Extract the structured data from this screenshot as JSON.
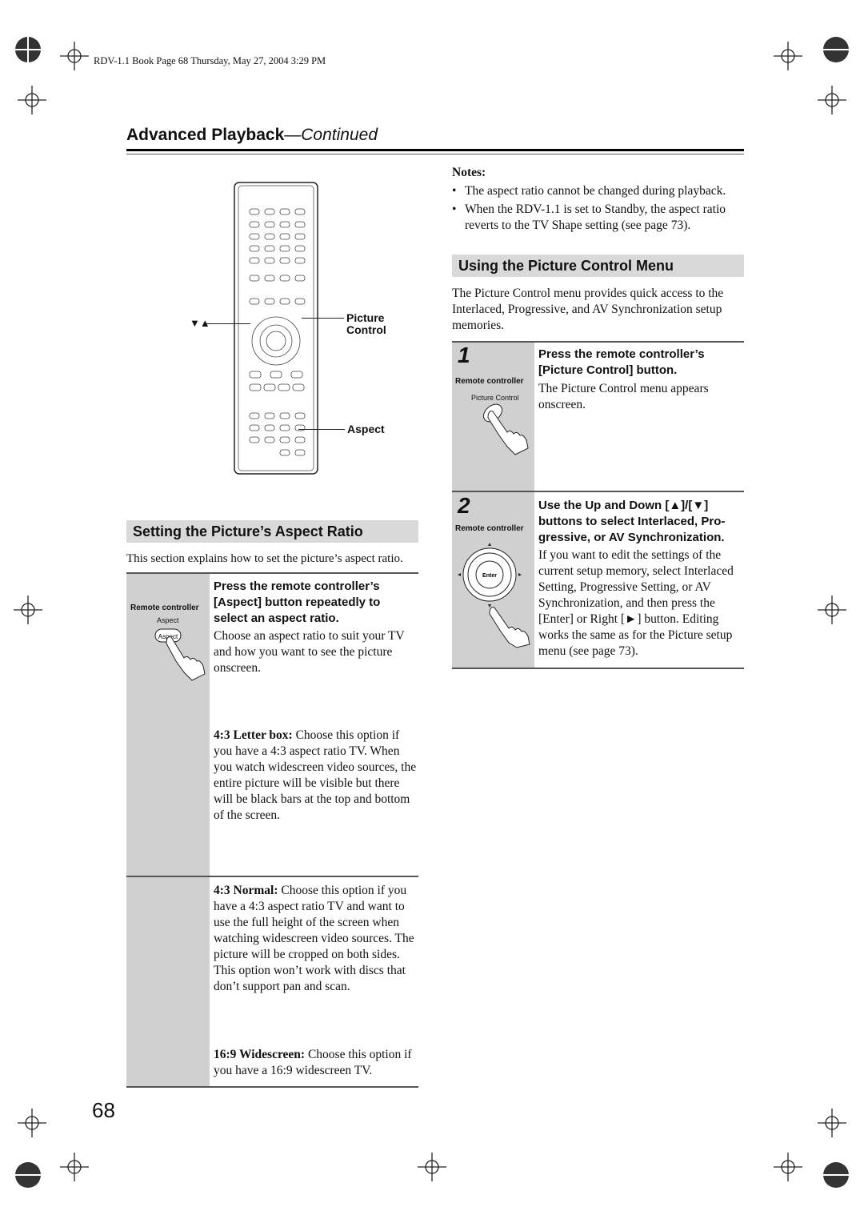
{
  "print_header": "RDV-1.1 Book Page 68 Thursday, May 27, 2004 3:29 PM",
  "title": {
    "main": "Advanced Playback",
    "sub": "—Continued"
  },
  "remote_figure": {
    "callout_arrows": "▼▲",
    "picture_control": [
      "Picture",
      "Control"
    ],
    "aspect": "Aspect"
  },
  "left": {
    "heading": "Setting the Picture’s Aspect Ratio",
    "intro": "This section explains how to set the picture’s aspect ratio.",
    "step": {
      "remote_label": "Remote controller",
      "button_label": "Aspect",
      "heading": "Press the remote controller’s [Aspect] button repeatedly to select an aspect ratio.",
      "body": "Choose an aspect ratio to suit your TV and how you want to see the picture onscreen."
    },
    "options": [
      {
        "name": "4:3 Letter box:",
        "text": " Choose this option if you have a 4:3 aspect ratio TV. When you watch widescreen video sources, the entire picture will be visible but there will be black bars at the top and bottom of the screen."
      },
      {
        "name": "4:3 Normal:",
        "text": " Choose this option if you have a 4:3 aspect ratio TV and want to use the full height of the screen when watching widescreen video sources. The picture will be cropped on both sides. This option won’t work with discs that don’t support pan and scan."
      },
      {
        "name": "16:9 Widescreen:",
        "text": " Choose this option if you have a 16:9 widescreen TV."
      }
    ]
  },
  "right": {
    "notes_title": "Notes:",
    "notes": [
      "The aspect ratio cannot be changed during playback.",
      "When the RDV-1.1 is set to Standby, the aspect ratio reverts to the TV Shape setting (see page 73)."
    ],
    "heading": "Using the Picture Control Menu",
    "intro": "The Picture Control menu provides quick access to the Interlaced, Progressive, and AV Synchronization setup memories.",
    "steps": [
      {
        "num": "1",
        "remote_label": "Remote controller",
        "button_label": "Picture Control",
        "heading": "Press the remote controller’s [Picture Control] button.",
        "body": "The Picture Control menu appears onscreen."
      },
      {
        "num": "2",
        "remote_label": "Remote controller",
        "button_label": "Enter",
        "heading": "Use the Up and Down [▲]/[▼] buttons to select Interlaced, Pro-gressive, or AV Synchronization.",
        "body": "If you want to edit the settings of the current setup memory, select Interlaced Setting, Progressive Setting, or AV Synchronization, and then press the [Enter] or Right [►] button. Editing works the same as for the Picture setup menu (see page 73)."
      }
    ]
  },
  "page_number": "68"
}
